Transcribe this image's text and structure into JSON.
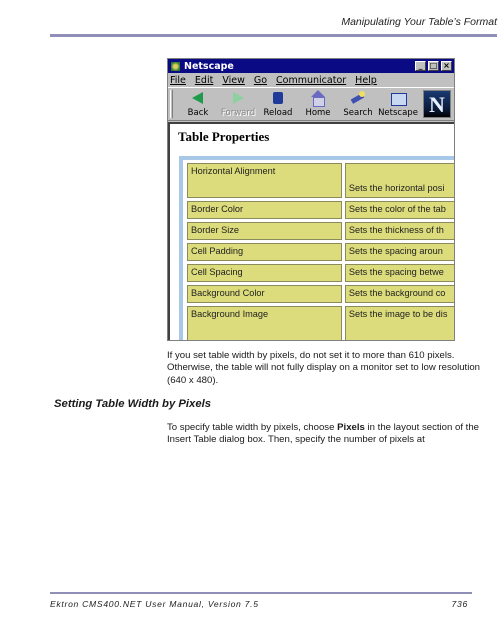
{
  "header": {
    "title": "Manipulating Your Table’s Format"
  },
  "browser": {
    "window_title": "Netscape",
    "window_controls": [
      "_",
      "□",
      "×"
    ],
    "menu": [
      "File",
      "Edit",
      "View",
      "Go",
      "Communicator",
      "Help"
    ],
    "toolbar": [
      {
        "label": "Back",
        "icon": "back-arrow-icon",
        "enabled": true
      },
      {
        "label": "Forward",
        "icon": "forward-arrow-icon",
        "enabled": false
      },
      {
        "label": "Reload",
        "icon": "reload-icon",
        "enabled": true
      },
      {
        "label": "Home",
        "icon": "home-icon",
        "enabled": true
      },
      {
        "label": "Search",
        "icon": "search-icon",
        "enabled": true
      },
      {
        "label": "Netscape",
        "icon": "netscape-icon",
        "enabled": true
      }
    ],
    "logo_letter": "N",
    "page": {
      "title": "Table Properties",
      "rows": [
        {
          "name": "Horizontal Alignment",
          "desc": "Sets the horizontal posi"
        },
        {
          "name": "Border Color",
          "desc": "Sets the color of the tab"
        },
        {
          "name": "Border Size",
          "desc": "Sets the thickness of th"
        },
        {
          "name": "Cell Padding",
          "desc": "Sets the spacing aroun"
        },
        {
          "name": "Cell Spacing",
          "desc": "Sets the spacing betwe"
        },
        {
          "name": "Background Color",
          "desc": "Sets the background co"
        },
        {
          "name": "Background Image",
          "desc": "Sets the image to be dis"
        }
      ]
    }
  },
  "note": "If you set table width by pixels, do not set it to more than 610 pixels. Otherwise, the table will not fully display on a monitor set to low resolution (640 x 480).",
  "section": {
    "heading": "Setting Table Width by Pixels",
    "para_before": "To specify table width by pixels, choose ",
    "para_bold": "Pixels",
    "para_after": " in the layout section of the Insert Table dialog box. Then, specify the number of pixels at"
  },
  "footer": {
    "manual": "Ektron CMS400.NET User Manual, Version 7.5",
    "page_number": "736"
  }
}
